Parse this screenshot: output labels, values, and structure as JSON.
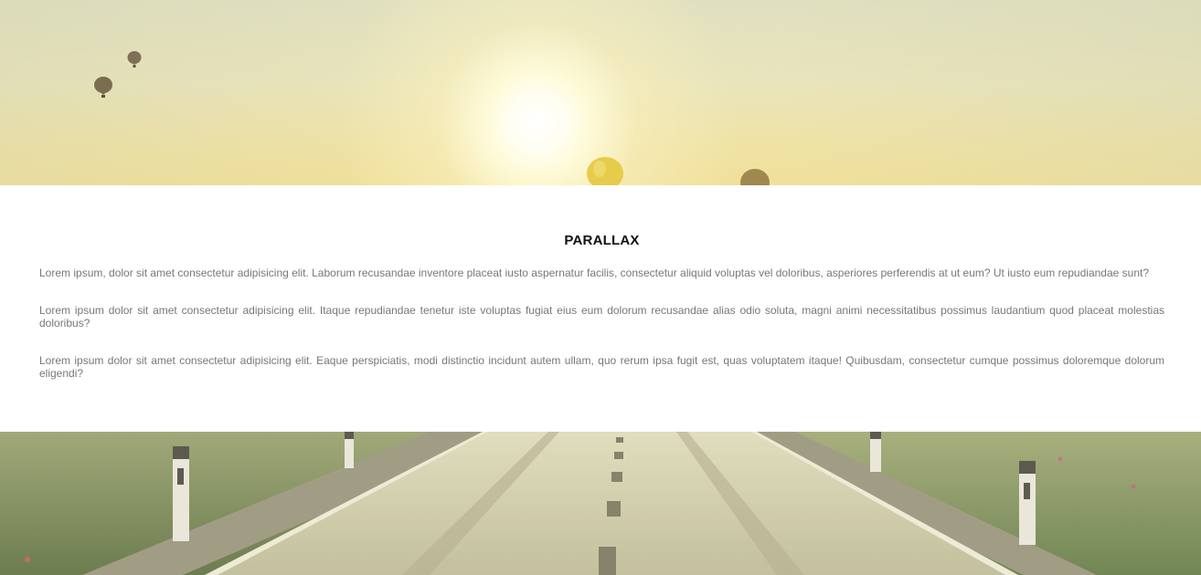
{
  "section": {
    "title": "PARALLAX",
    "paragraphs": [
      "Lorem ipsum, dolor sit amet consectetur adipisicing elit. Laborum recusandae inventore placeat iusto aspernatur facilis, consectetur aliquid voluptas vel doloribus, asperiores perferendis at ut eum? Ut iusto eum repudiandae sunt?",
      "Lorem ipsum dolor sit amet consectetur adipisicing elit. Itaque repudiandae tenetur iste voluptas fugiat eius eum dolorum recusandae alias odio soluta, magni animi necessitatibus possimus laudantium quod placeat molestias doloribus?",
      "Lorem ipsum dolor sit amet consectetur adipisicing elit. Eaque perspiciatis, modi distinctio incidunt autem ullam, quo rerum ipsa fugit est, quas voluptatem itaque! Quibusdam, consectetur cumque possimus doloremque dolorum eligendi?"
    ]
  },
  "images": {
    "top": "hot-air-balloons-sky-image",
    "bottom": "road-landscape-image"
  },
  "colors": {
    "sky_light": "#efe2a4",
    "sun": "#ffffff",
    "balloon_dark": "#7a6d52",
    "balloon_yellow": "#e8cf4e",
    "title": "#111111",
    "body_text": "#777777",
    "road": "#c9c7a2",
    "grass": "#5f7040"
  }
}
